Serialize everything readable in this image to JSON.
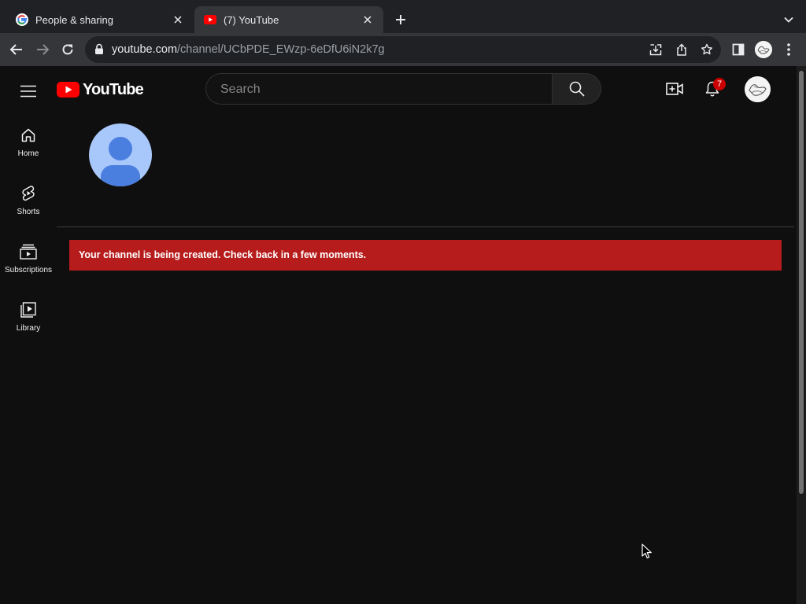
{
  "browser": {
    "tabs": [
      {
        "title": "People & sharing",
        "icon": "google-icon",
        "active": false
      },
      {
        "title": "(7) YouTube",
        "icon": "youtube-icon",
        "active": true
      }
    ],
    "url": {
      "host": "youtube.com",
      "path": "/channel/UCbPDE_EWzp-6eDfU6iN2k7g"
    }
  },
  "youtube": {
    "logo_text": "YouTube",
    "search_placeholder": "Search",
    "notification_count": "7",
    "guide": [
      {
        "label": "Home",
        "icon": "home-icon"
      },
      {
        "label": "Shorts",
        "icon": "shorts-icon"
      },
      {
        "label": "Subscriptions",
        "icon": "subscriptions-icon"
      },
      {
        "label": "Library",
        "icon": "library-icon"
      }
    ],
    "alert_message": "Your channel is being created. Check back in a few moments."
  },
  "colors": {
    "youtube_red": "#ff0000",
    "alert_bg": "#b71c1c",
    "page_bg": "#0f0f0f",
    "default_avatar": "#a8c7fa"
  }
}
